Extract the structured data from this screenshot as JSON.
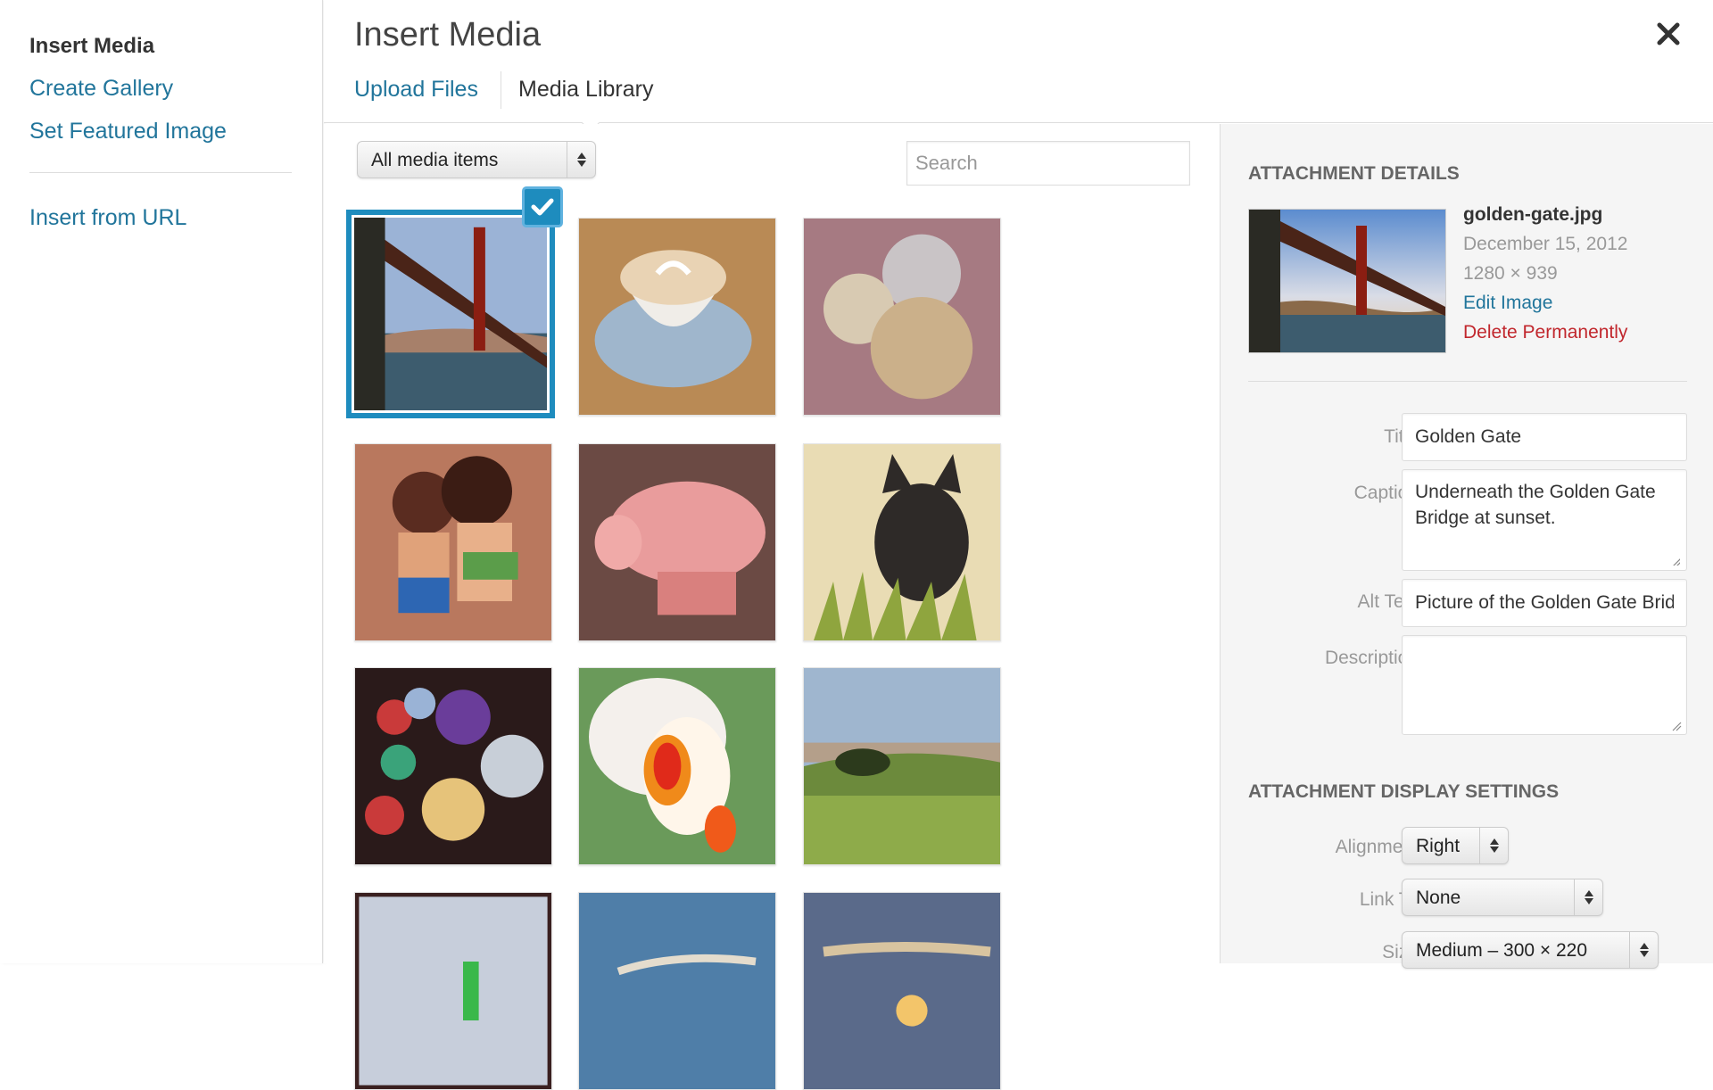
{
  "sidebar": {
    "heading": "Insert Media",
    "links": [
      "Create Gallery",
      "Set Featured Image"
    ],
    "insert_from_url": "Insert from URL"
  },
  "header": {
    "title": "Insert Media",
    "close_icon": "close-icon",
    "tabs": [
      {
        "label": "Upload Files",
        "active": false
      },
      {
        "label": "Media Library",
        "active": true
      }
    ]
  },
  "toolbar": {
    "filter_value": "All media items",
    "search_placeholder": "Search"
  },
  "grid": {
    "items": [
      {
        "name": "golden-gate",
        "selected": true
      },
      {
        "name": "latte",
        "selected": false
      },
      {
        "name": "coins",
        "selected": false
      },
      {
        "name": "kissing-figurines",
        "selected": false
      },
      {
        "name": "pink-pig",
        "selected": false
      },
      {
        "name": "black-cat",
        "selected": false
      },
      {
        "name": "paper-lanterns",
        "selected": false
      },
      {
        "name": "orchid",
        "selected": false
      },
      {
        "name": "hillside",
        "selected": false
      },
      {
        "name": "fridge",
        "selected": false
      },
      {
        "name": "sky",
        "selected": false
      },
      {
        "name": "sunset",
        "selected": false
      }
    ]
  },
  "details": {
    "section_title": "ATTACHMENT DETAILS",
    "filename": "golden-gate.jpg",
    "date": "December 15, 2012",
    "dimensions": "1280 × 939",
    "edit_label": "Edit Image",
    "delete_label": "Delete Permanently",
    "fields": {
      "title_label": "Title",
      "title_value": "Golden Gate",
      "caption_label": "Caption",
      "caption_value": "Underneath the Golden Gate Bridge at sunset.",
      "alt_label": "Alt Text",
      "alt_value": "Picture of the Golden Gate Bridge",
      "description_label": "Description",
      "description_value": ""
    }
  },
  "display_settings": {
    "section_title": "ATTACHMENT DISPLAY SETTINGS",
    "alignment_label": "Alignment",
    "alignment_value": "Right",
    "link_label": "Link To",
    "link_value": "None",
    "size_label": "Size",
    "size_value": "Medium – 300 × 220"
  },
  "colors": {
    "link": "#21759b",
    "accent": "#1e8cbe",
    "danger": "#c1272d"
  }
}
